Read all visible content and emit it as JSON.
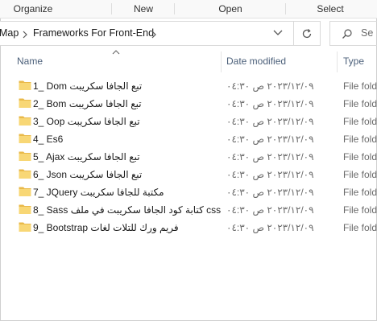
{
  "ribbon": {
    "groups": [
      "Organize",
      "New",
      "Open",
      "Select"
    ]
  },
  "address": {
    "crumbs": [
      "Map",
      "Frameworks For Front-End"
    ]
  },
  "search": {
    "placeholder": "Se"
  },
  "columns": {
    "name": "Name",
    "date": "Date modified",
    "type": "Type"
  },
  "files": [
    {
      "name": "1_ Dom تبع الجافا سكريبت",
      "date": "٢٠٢٣/١٢/٠٩ ص ٠٤:٣٠",
      "type": "File fold"
    },
    {
      "name": "2_ Bom تبع الجافا سكريبت",
      "date": "٢٠٢٣/١٢/٠٩ ص ٠٤:٣٠",
      "type": "File fold"
    },
    {
      "name": "3_ Oop تبع الجافا سكريبت",
      "date": "٢٠٢٣/١٢/٠٩ ص ٠٤:٣٠",
      "type": "File fold"
    },
    {
      "name": "4_ Es6",
      "date": "٢٠٢٣/١٢/٠٩ ص ٠٤:٣٠",
      "type": "File fold"
    },
    {
      "name": "5_ Ajax تبع الجافا سكريبت",
      "date": "٢٠٢٣/١٢/٠٩ ص ٠٤:٣٠",
      "type": "File fold"
    },
    {
      "name": "6_ Json تبع الجافا سكريبت",
      "date": "٢٠٢٣/١٢/٠٩ ص ٠٤:٣٠",
      "type": "File fold"
    },
    {
      "name": "7_ JQuery مكتبة للجافا سكريبت",
      "date": "٢٠٢٣/١٢/٠٩ ص ٠٤:٣٠",
      "type": "File fold"
    },
    {
      "name": "8_ Sass كتابة كود الجافا سكريبت في ملف css",
      "date": "٢٠٢٣/١٢/٠٩ ص ٠٤:٣٠",
      "type": "File fold"
    },
    {
      "name": "9_ Bootstrap فريم ورك للتلات لغات",
      "date": "٢٠٢٣/١٢/٠٩ ص ٠٤:٣٠",
      "type": "File fold"
    }
  ],
  "colors": {
    "folder": "#f8d775",
    "folder_dark": "#e9b949",
    "header_text": "#4c607a"
  },
  "icons": {
    "folder": "folder-icon",
    "refresh": "refresh-icon",
    "search": "search-icon",
    "chevron": "chevron-right-icon",
    "dropdown": "chevron-down-icon",
    "sort": "sort-up-icon"
  }
}
